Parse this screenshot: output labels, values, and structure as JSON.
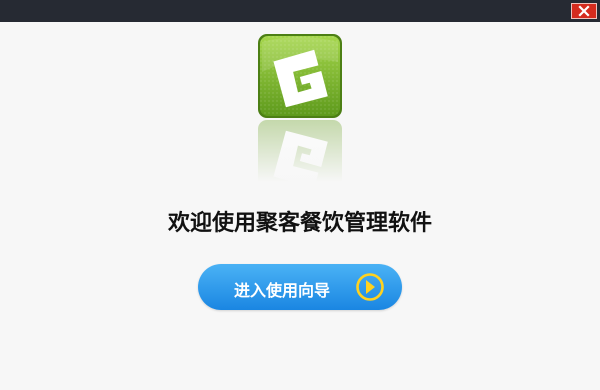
{
  "window": {
    "close_icon": "close-icon"
  },
  "logo": {
    "icon": "g-logo-icon",
    "color": "#7cb82f"
  },
  "welcome": {
    "title": "欢迎使用聚客餐饮管理软件"
  },
  "guide_button": {
    "label": "进入使用向导",
    "icon": "arrow-right-circle-icon",
    "color": "#2a95ea"
  }
}
